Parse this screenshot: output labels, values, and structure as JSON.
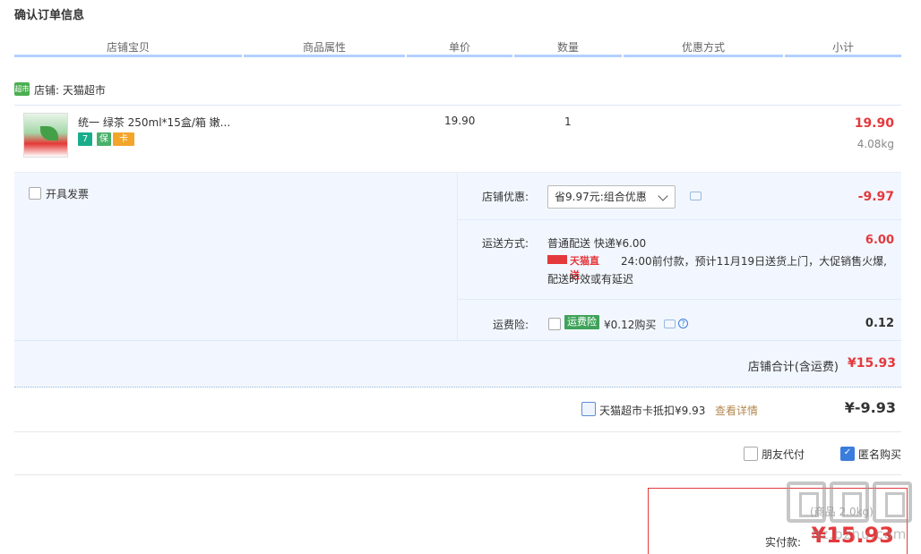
{
  "page": {
    "title": "确认订单信息"
  },
  "columns": [
    "店铺宝贝",
    "商品属性",
    "单价",
    "数量",
    "优惠方式",
    "小计"
  ],
  "shop": {
    "icon_text": "超市",
    "label": "店铺: 天猫超市"
  },
  "item": {
    "name": "统一 绿茶 250ml*15盒/箱 嫩...",
    "badges": [
      "7",
      "保",
      "卡"
    ],
    "price": "19.90",
    "quantity": "1",
    "subtotal": "19.90",
    "weight": "4.08kg"
  },
  "invoice": {
    "label": "开具发票"
  },
  "shop_discount": {
    "label": "店铺优惠:",
    "selected": "省9.97元:组合优惠",
    "amount": "-9.97"
  },
  "shipping": {
    "label": "运送方式:",
    "method": "普通配送 快递¥6.00",
    "amount": "6.00",
    "tmall_logo": "天猫直送",
    "note_line1": "24:00前付款，预计11月19日送货上门，大促销售火爆,",
    "note_line2": "配送时效或有延迟"
  },
  "insurance": {
    "label": "运费险:",
    "badge": "运费险",
    "price_text": "¥0.12购买",
    "amount": "0.12",
    "help": "?"
  },
  "shop_total": {
    "label": "店铺合计(含运费)",
    "value": "¥15.93"
  },
  "card": {
    "label": "天猫超市卡抵扣¥9.93",
    "link": "查看详情",
    "amount": "¥-9.93"
  },
  "options": {
    "friend_pay": "朋友代付",
    "anonymous": "匿名购买",
    "anonymous_check": "✓"
  },
  "payment": {
    "faded_text": "(商品 2.0kg)",
    "label": "实付款:",
    "amount": "¥15.93"
  },
  "watermark": {
    "text": "hz.bzhu.com"
  }
}
